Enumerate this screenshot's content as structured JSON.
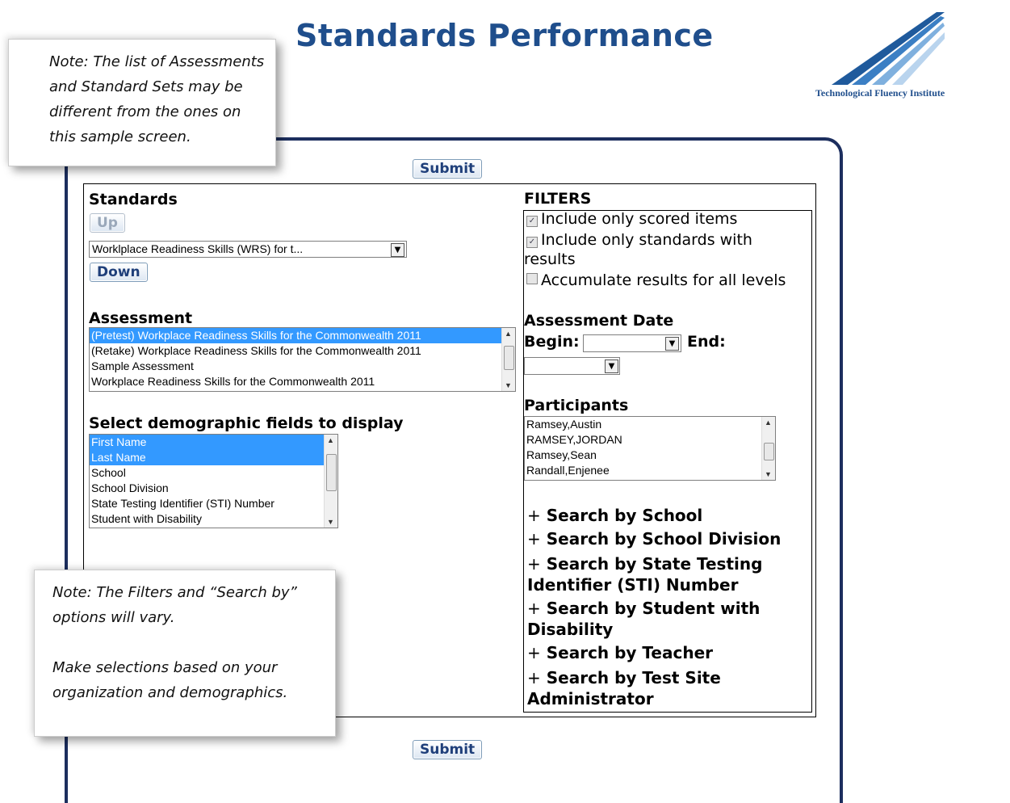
{
  "page": {
    "title": "Standards Performance"
  },
  "logo": {
    "text": "Technological Fluency Institute",
    "color": "#1f4e8c"
  },
  "buttons": {
    "submit_top": "Submit",
    "submit_bottom": "Submit"
  },
  "standards": {
    "heading": "Standards",
    "up_label": "Up",
    "down_label": "Down",
    "selected_value": "Worklplace Readiness Skills (WRS) for t..."
  },
  "assessment": {
    "heading": "Assessment",
    "options": [
      {
        "label": "(Pretest) Workplace Readiness Skills for the Commonwealth 2011",
        "selected": true
      },
      {
        "label": "(Retake) Workplace Readiness Skills for the Commonwealth 2011",
        "selected": false
      },
      {
        "label": "Sample Assessment",
        "selected": false
      },
      {
        "label": "Workplace Readiness Skills for the Commonwealth 2011",
        "selected": false
      }
    ]
  },
  "demographics": {
    "heading": "Select demographic fields to display",
    "options": [
      {
        "label": "First Name",
        "selected": true
      },
      {
        "label": "Last Name",
        "selected": true
      },
      {
        "label": "School",
        "selected": false
      },
      {
        "label": "School Division",
        "selected": false
      },
      {
        "label": "State Testing Identifier (STI) Number",
        "selected": false
      },
      {
        "label": "Student with Disability",
        "selected": false
      }
    ]
  },
  "filters": {
    "heading": "FILTERS",
    "checkboxes": [
      {
        "label": "Include only scored items",
        "checked": true
      },
      {
        "label": "Include only standards with",
        "label_cont": "results",
        "checked": true
      },
      {
        "label": "Accumulate results for all levels",
        "checked": false
      }
    ],
    "date_heading": "Assessment Date",
    "begin_label": "Begin:",
    "end_label": "End:"
  },
  "participants": {
    "heading": "Participants",
    "options": [
      "Ramsey,Austin",
      "RAMSEY,JORDAN",
      "Ramsey,Sean",
      "Randall,Enjenee"
    ]
  },
  "search_links": [
    {
      "plus": "+",
      "label": "Search by School"
    },
    {
      "plus": "+",
      "label": "Search by School Division"
    },
    {
      "plus": "+",
      "label": "Search by State Testing",
      "label2": "Identifier (STI) Number"
    },
    {
      "plus": "+",
      "label": "Search by Student with",
      "label2": "Disability"
    },
    {
      "plus": "+",
      "label": "Search by Teacher"
    },
    {
      "plus": "+",
      "label": "Search by Test Site",
      "label2": "Administrator"
    }
  ],
  "notes": {
    "top": [
      "Note: The list of Assessments",
      "and Standard Sets may be",
      "different from the ones on",
      "this sample screen."
    ],
    "bottom": [
      "Note: The Filters and “Search by”",
      "options will vary.",
      "",
      "Make selections based on your",
      "organization and demographics."
    ]
  },
  "colors": {
    "title": "#1f4e8c",
    "panel_border": "#1c2e5e",
    "selection": "#3399ff"
  }
}
